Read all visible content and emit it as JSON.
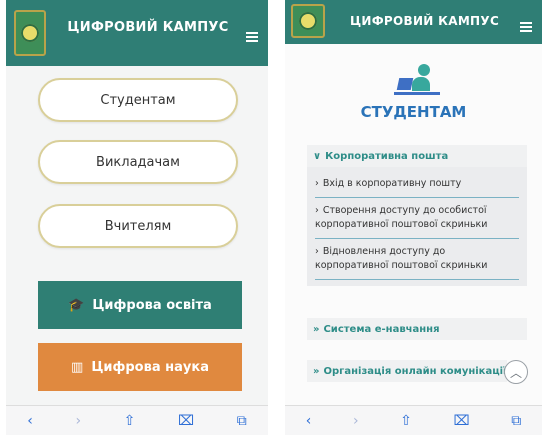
{
  "left_screen": {
    "header_title": "ЦИФРОВИЙ КАМПУС",
    "buttons": [
      {
        "label": "Студентам"
      },
      {
        "label": "Викладачам"
      },
      {
        "label": "Вчителям"
      }
    ],
    "tiles": [
      {
        "label": "Цифрова освіта",
        "icon": "graduation-cap-icon",
        "color": "#2f7f74"
      },
      {
        "label": "Цифрова наука",
        "icon": "bar-chart-icon",
        "color": "#e0893f"
      }
    ],
    "tile_partial_color": "#3c4f8b"
  },
  "right_screen": {
    "header_title": "ЦИФРОВИЙ КАМПУС",
    "page_heading": "СТУДЕНТАМ",
    "sections": [
      {
        "title": "Корпоративна пошта",
        "expanded": true,
        "items": [
          "Вхід в корпоративну пошту",
          "Створення доступу до особистої корпоративної поштової скриньки",
          "Відновлення доступу до корпоративної поштової скриньки"
        ]
      },
      {
        "title": "Система е-навчання",
        "expanded": false
      },
      {
        "title": "Організація онлайн комунікації",
        "expanded": false
      }
    ]
  },
  "browser_bar": {
    "icons": [
      "back-icon",
      "forward-icon",
      "share-icon",
      "bookmarks-icon",
      "tabs-icon"
    ],
    "glyphs": [
      "‹",
      "›",
      "⇧",
      "⌧",
      "⧉"
    ]
  },
  "colors": {
    "header": "#2f7e75",
    "accent_teal": "#2e8d88",
    "heading_blue": "#2a73b8"
  }
}
